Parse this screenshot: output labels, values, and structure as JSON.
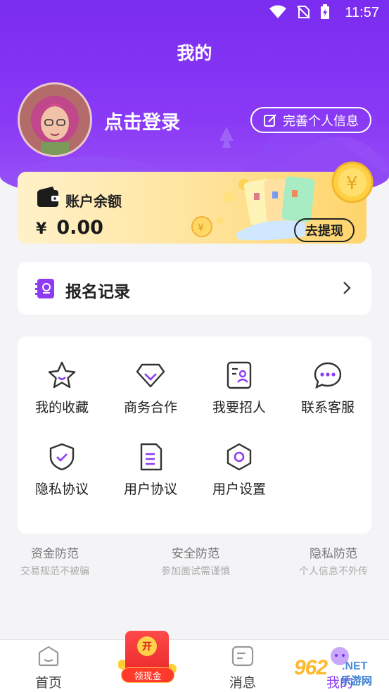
{
  "status_bar": {
    "time": "11:57"
  },
  "header": {
    "title": "我的"
  },
  "profile": {
    "login_text": "点击登录",
    "edit_button": "完善个人信息"
  },
  "balance": {
    "label": "账户余额",
    "currency": "¥",
    "amount": "0.00",
    "withdraw_button": "去提现"
  },
  "record": {
    "label": "报名记录"
  },
  "grid": {
    "items": [
      {
        "label": "我的收藏",
        "icon": "star-icon"
      },
      {
        "label": "商务合作",
        "icon": "diamond-icon"
      },
      {
        "label": "我要招人",
        "icon": "recruit-icon"
      },
      {
        "label": "联系客服",
        "icon": "chat-icon"
      },
      {
        "label": "隐私协议",
        "icon": "shield-icon"
      },
      {
        "label": "用户协议",
        "icon": "document-icon"
      },
      {
        "label": "用户设置",
        "icon": "settings-icon"
      }
    ]
  },
  "safety": [
    {
      "title": "资金防范",
      "subtitle": "交易规范不被骗"
    },
    {
      "title": "安全防范",
      "subtitle": "参加面试需谨慎"
    },
    {
      "title": "隐私防范",
      "subtitle": "个人信息不外传"
    }
  ],
  "bottom_nav": {
    "items": [
      {
        "label": "首页",
        "icon": "home-icon"
      },
      {
        "label": "消息",
        "icon": "message-icon"
      },
      {
        "label": "我的",
        "icon": "mine-icon"
      }
    ],
    "promo": {
      "badge": "开",
      "label": "领现金"
    }
  },
  "watermark": {
    "number": "962",
    "suffix": ".NET",
    "text": "乐游网"
  },
  "colors": {
    "primary": "#7a2cf0",
    "gold": "#ffd46b",
    "background": "#f4f4f7"
  }
}
